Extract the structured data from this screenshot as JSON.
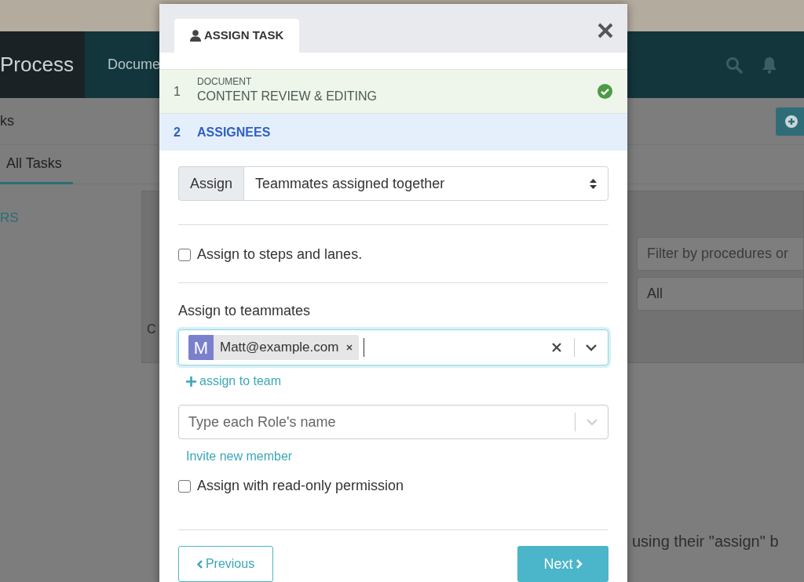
{
  "app": {
    "logo": "Process",
    "nav_items": [
      "Docume"
    ],
    "page_title": "ks",
    "tabs": [
      {
        "label": "All Tasks",
        "selected": true
      }
    ],
    "sidebar_text": "RS",
    "filter": {
      "placeholder": "Filter by procedures or"
    },
    "status_select": {
      "value": "All"
    },
    "cut_text": "C",
    "hint_text": "using their \"assign\" b"
  },
  "modal": {
    "tab": "ASSIGN TASK",
    "steps": [
      {
        "number": "1",
        "category": "DOCUMENT",
        "title": "CONTENT REVIEW & EDITING",
        "done": true,
        "selected": false
      },
      {
        "number": "2",
        "title": "ASSIGNEES",
        "done": false,
        "selected": true
      }
    ],
    "assign_mode": {
      "addon": "Assign",
      "value": "Teammates assigned together"
    },
    "steps_lanes": {
      "label": "Assign to steps and lanes.",
      "checked": false
    },
    "teammates": {
      "label": "Assign to teammates",
      "focused": true,
      "chips": [
        {
          "initial": "M",
          "name": "Matt@example.com"
        }
      ]
    },
    "assign_team_link": "assign to team",
    "role_field": {
      "placeholder": "Type each Role's name"
    },
    "invite_link": "Invite new member",
    "read_only": {
      "label": "Assign with read-only permission",
      "checked": false
    },
    "buttons": {
      "previous": "Previous",
      "next": "Next"
    }
  }
}
